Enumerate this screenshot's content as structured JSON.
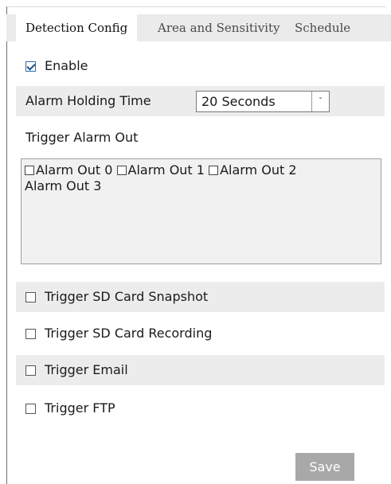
{
  "tabs": [
    {
      "label": "Detection Config",
      "active": true
    },
    {
      "label": "Area and Sensitivity",
      "active": false
    },
    {
      "label": "Schedule",
      "active": false
    }
  ],
  "enable": {
    "label": "Enable",
    "checked": true
  },
  "alarm_holding": {
    "label": "Alarm Holding Time",
    "value": "20 Seconds"
  },
  "trigger_alarm_out": {
    "label": "Trigger Alarm Out",
    "items": [
      {
        "label": "Alarm Out 0",
        "checked": false
      },
      {
        "label": "Alarm Out 1",
        "checked": false
      },
      {
        "label": "Alarm Out 2",
        "checked": false
      },
      {
        "label": "Alarm Out 3",
        "checked": false
      }
    ]
  },
  "options": [
    {
      "label": "Trigger SD Card Snapshot",
      "checked": false
    },
    {
      "label": "Trigger SD Card Recording",
      "checked": false
    },
    {
      "label": "Trigger Email",
      "checked": false
    },
    {
      "label": "Trigger FTP",
      "checked": false
    }
  ],
  "save_label": "Save",
  "colors": {
    "accent_check": "#1a4f8a",
    "row_bg": "#ececec",
    "save_bg": "#a8a8a8"
  }
}
